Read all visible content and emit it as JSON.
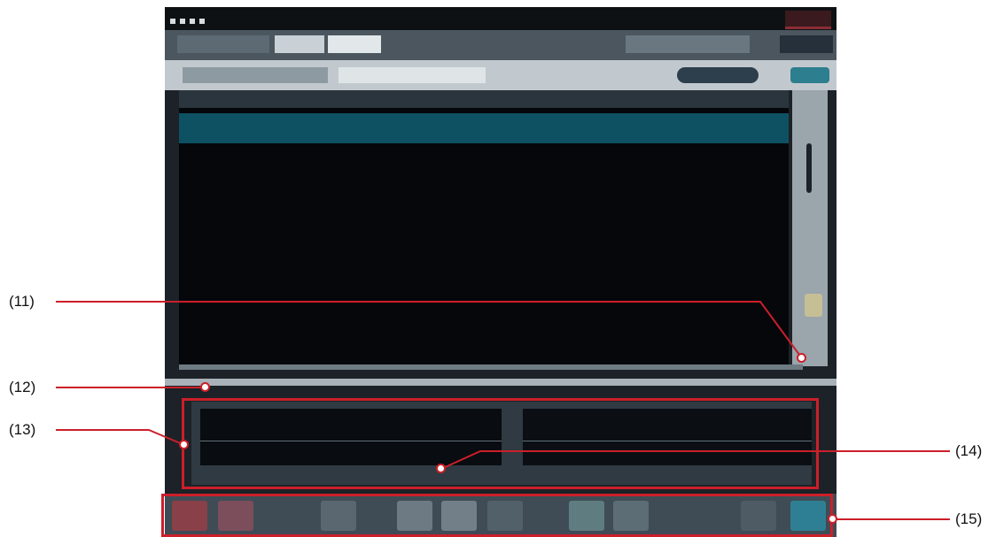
{
  "screen": {
    "tabs": [
      "",
      "",
      "",
      "",
      ""
    ],
    "sub_tabs": [
      "",
      ""
    ],
    "sub_button_label": "",
    "sub_button2_label": "",
    "list_columns": [
      "",
      "",
      "",
      "",
      "",
      ""
    ],
    "list_rows": [
      [
        "",
        "",
        "",
        "",
        "",
        ""
      ],
      [
        "",
        "",
        "",
        "",
        "",
        ""
      ],
      [
        "",
        "",
        "",
        "",
        "",
        ""
      ],
      [
        "",
        "",
        "",
        "",
        "",
        ""
      ],
      [
        "",
        "",
        "",
        "",
        "",
        ""
      ]
    ],
    "info_text": [
      "",
      "",
      ""
    ],
    "toolbar_buttons": [
      "",
      "",
      "",
      "",
      "",
      "",
      "",
      "",
      "",
      ""
    ]
  },
  "callouts": {
    "c11": "(11)",
    "c12": "(12)",
    "c13": "(13)",
    "c14": "(14)",
    "c15": "(15)"
  },
  "colors": {
    "annotation_red": "#cc1f2a",
    "selected_row": "#0e5163",
    "list_background": "#05070b"
  }
}
